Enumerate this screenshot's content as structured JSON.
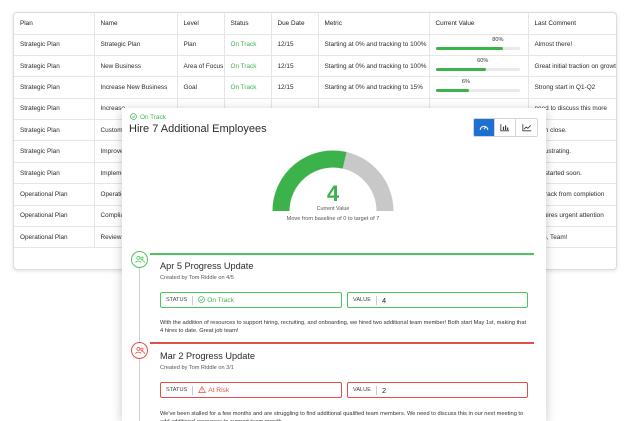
{
  "table": {
    "headers": [
      "Plan",
      "Name",
      "Level",
      "Status",
      "Due Date",
      "Metric",
      "Current Value",
      "Last Comment"
    ],
    "rows": [
      {
        "plan": "Strategic Plan",
        "name": "Strategic Plan",
        "level": "Plan",
        "status": "On Track",
        "due": "12/15",
        "metric": "Starting at 0% and tracking to 100%",
        "value": "80%",
        "progress": 0.8,
        "comment": "Almost there!"
      },
      {
        "plan": "Strategic Plan",
        "name": "New Business",
        "level": "Area of Focus",
        "status": "On Track",
        "due": "12/15",
        "metric": "Starting at 0% and tracking to 100%",
        "value": "60%",
        "progress": 0.6,
        "comment": "Great initial traction on growth"
      },
      {
        "plan": "Strategic Plan",
        "name": "Increase New Business",
        "level": "Goal",
        "status": "On Track",
        "due": "12/15",
        "metric": "Starting at 0% and tracking to 15%",
        "value": "6%",
        "progress": 0.4,
        "comment": "Strong start in Q1-Q2"
      },
      {
        "plan": "Strategic Plan",
        "name": "Increase",
        "level": "",
        "status": "",
        "due": "",
        "metric": "",
        "value": "",
        "progress": null,
        "comment": "need to discuss this more"
      },
      {
        "plan": "Strategic Plan",
        "name": "Custome",
        "level": "",
        "status": "",
        "due": "",
        "metric": "",
        "value": "",
        "progress": null,
        "comment": "even close."
      },
      {
        "plan": "Strategic Plan",
        "name": "Improve",
        "level": "",
        "status": "",
        "due": "",
        "metric": "",
        "value": "",
        "progress": null,
        "comment": "is frustrating."
      },
      {
        "plan": "Strategic Plan",
        "name": "Impleme",
        "level": "",
        "status": "",
        "due": "",
        "metric": "",
        "value": "",
        "progress": null,
        "comment": "ing started soon."
      },
      {
        "plan": "Operational Plan",
        "name": "Operatic",
        "level": "",
        "status": "",
        "due": "",
        "metric": "",
        "value": "",
        "progress": null,
        "comment": "off track from completion"
      },
      {
        "plan": "Operational Plan",
        "name": "Complia",
        "level": "",
        "status": "",
        "due": "",
        "metric": "",
        "value": "",
        "progress": null,
        "comment": "requires urgent attention"
      },
      {
        "plan": "Operational Plan",
        "name": "Review I",
        "level": "",
        "status": "",
        "due": "",
        "metric": "",
        "value": "",
        "progress": null,
        "comment": "t job, Team!"
      }
    ]
  },
  "panel": {
    "status_label": "On Track",
    "title": "Hire 7 Additional Employees",
    "view_buttons": [
      "gauge-icon",
      "bar-chart-icon",
      "line-chart-icon"
    ],
    "gauge": {
      "value": "4",
      "current": 4,
      "target": 7,
      "caption": "Current Value",
      "subtitle": "Move from baseline of 0 to target of 7"
    },
    "updates": [
      {
        "title": "Apr 5 Progress Update",
        "meta": "Created by Tom Riddle on 4/5",
        "status_label": "STATUS",
        "status_value": "On Track",
        "value_label": "VALUE",
        "value": "4",
        "body": "With the addition of resources to support hiring, recruiting, and onboarding, we hired two additional team member! Both start May 1st, making that 4 hires to date. Great job team!",
        "tone": "green"
      },
      {
        "title": "Mar 2 Progress Update",
        "meta": "Created by Tom Riddle on 3/1",
        "status_label": "STATUS",
        "status_value": "At Risk",
        "value_label": "VALUE",
        "value": "2",
        "body": "We've been stalled for a few months and are struggling to find additional qualified team members. We need to discuss this in our next meeting to add additional resources to support team growth.",
        "tone": "red"
      }
    ]
  },
  "colors": {
    "on_track": "#3fb34f",
    "at_risk": "#e0504a",
    "gauge_fill": "#3bb34a",
    "gauge_track": "#c8c8c8",
    "active_button": "#1f6fd1"
  }
}
